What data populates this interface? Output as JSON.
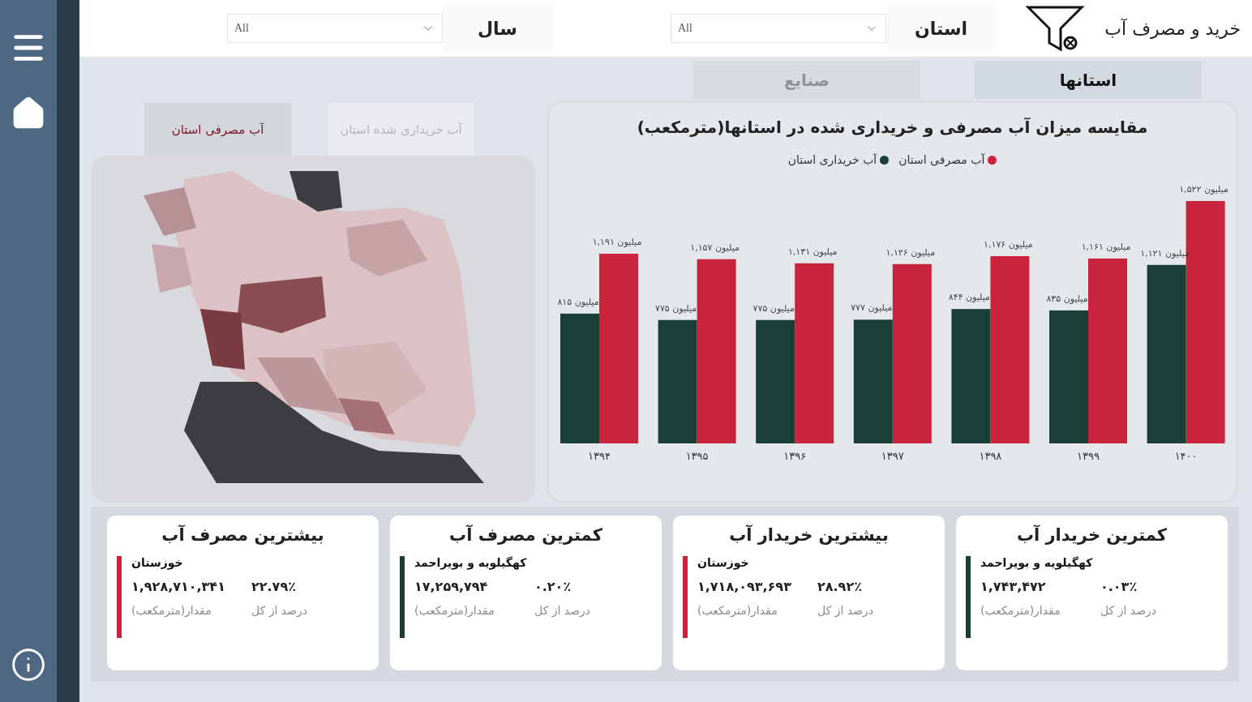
{
  "header": {
    "title": "خرید و مصرف آب",
    "filters": [
      {
        "label": "استان",
        "value": "All"
      },
      {
        "label": "سال",
        "value": "All"
      }
    ]
  },
  "tabs": [
    {
      "label": "استانها",
      "selected": true
    },
    {
      "label": "صنایع",
      "selected": false
    }
  ],
  "map_panel": {
    "tabs": [
      {
        "label": "آب خریداری شده استان",
        "selected": false
      },
      {
        "label": "آب مصرفی استان",
        "selected": true
      }
    ]
  },
  "chart": {
    "chart_data": {
      "type": "bar",
      "title": "مقایسه میزان آب مصرفی و خریداری شده در استانها(مترمکعب)",
      "categories": [
        "۱۳۹۴",
        "۱۳۹۵",
        "۱۳۹۶",
        "۱۳۹۷",
        "۱۳۹۸",
        "۱۳۹۹",
        "۱۴۰۰"
      ],
      "data_labels": true,
      "series": [
        {
          "name": "آب مصرفی استان",
          "color": "#c8243c",
          "values": [
            1191,
            1157,
            1131,
            1126,
            1176,
            1161,
            1522
          ],
          "value_labels": [
            "میلیون ۱,۱۹۱",
            "میلیون ۱,۱۵۷",
            "میلیون ۱,۱۳۱",
            "میلیون ۱,۱۲۶",
            "میلیون ۱,۱۷۶",
            "میلیون ۱,۱۶۱",
            "میلیون ۱,۵۲۲"
          ]
        },
        {
          "name": "آب خریداری استان",
          "color": "#1a3f36",
          "values": [
            815,
            775,
            775,
            777,
            844,
            835,
            1121
          ],
          "value_labels": [
            "میلیون ۸۱۵",
            "میلیون ۷۷۵",
            "میلیون ۷۷۵",
            "میلیون ۷۷۷",
            "میلیون ۸۴۴",
            "میلیون ۸۳۵",
            "میلیون ۱,۱۲۱"
          ]
        }
      ]
    }
  },
  "cards": [
    {
      "title": "کمترین خریدار آب",
      "name": "کهگیلویه و بویراحمد",
      "amount": "۱,۷۴۳,۴۷۲",
      "percent": "۰.۰۳٪",
      "amount_label": "مقدار(مترمکعب)",
      "percent_label": "درصد از کل",
      "color": "#1a3f36"
    },
    {
      "title": "بیشترین خریدار آب",
      "name": "خوزستان",
      "amount": "۱,۷۱۸,۰۹۳,۶۹۳",
      "percent": "۲۸.۹۲٪",
      "amount_label": "مقدار(مترمکعب)",
      "percent_label": "درصد از کل",
      "color": "#c8243c"
    },
    {
      "title": "کمترین مصرف آب",
      "name": "کهگیلویه و بویراحمد",
      "amount": "۱۷,۲۵۹,۷۹۴",
      "percent": "۰.۲۰٪",
      "amount_label": "مقدار(مترمکعب)",
      "percent_label": "درصد از کل",
      "color": "#1a3f36"
    },
    {
      "title": "بیشترین مصرف آب",
      "name": "خوزستان",
      "amount": "۱,۹۲۸,۷۱۰,۳۴۱",
      "percent": "۲۲.۷۹٪",
      "amount_label": "مقدار(مترمکعب)",
      "percent_label": "درصد از کل",
      "color": "#c8243c"
    }
  ]
}
